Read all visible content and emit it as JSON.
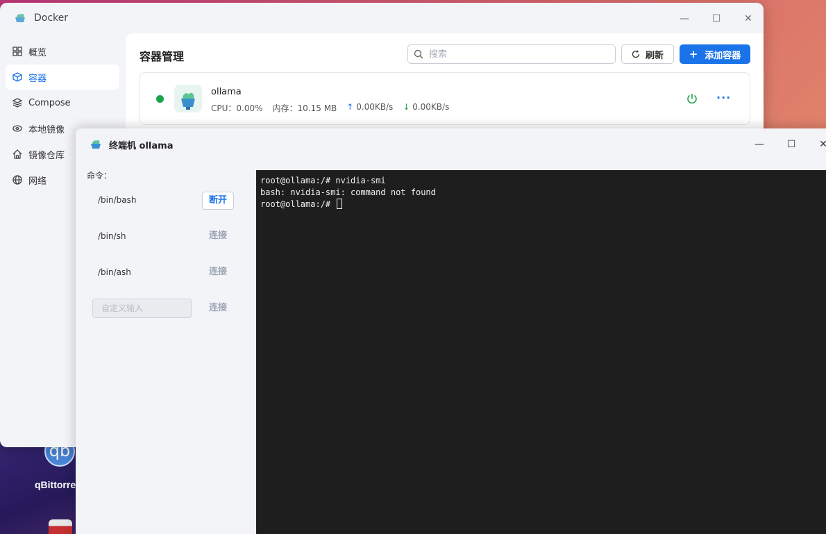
{
  "desktop": {
    "qbittorrent_label": "qBittorre"
  },
  "docker_window": {
    "title": "Docker",
    "sidebar": {
      "items": [
        {
          "label": "概览",
          "icon": "grid-icon"
        },
        {
          "label": "容器",
          "icon": "cube-icon",
          "active": true
        },
        {
          "label": "Compose",
          "icon": "layers-icon"
        },
        {
          "label": "本地镜像",
          "icon": "disk-icon"
        },
        {
          "label": "镜像仓库",
          "icon": "home-icon"
        },
        {
          "label": "网络",
          "icon": "globe-icon"
        }
      ]
    },
    "main": {
      "title": "容器管理",
      "search_placeholder": "搜索",
      "refresh_label": "刷新",
      "add_label": "添加容器",
      "container": {
        "name": "ollama",
        "status": "running",
        "status_color": "#1aa34a",
        "cpu": "CPU：0.00%",
        "memory": "内存：10.15 MB",
        "upload": "0.00KB/s",
        "download": "0.00KB/s"
      }
    }
  },
  "terminal_window": {
    "title": "终端机 ollama",
    "command_label": "命令：",
    "commands": [
      {
        "name": "/bin/bash",
        "action": "断开",
        "state": "connected"
      },
      {
        "name": "/bin/sh",
        "action": "连接",
        "state": "idle"
      },
      {
        "name": "/bin/ash",
        "action": "连接",
        "state": "idle"
      }
    ],
    "custom_placeholder": "自定义输入",
    "custom_action": "连接",
    "terminal_lines": [
      "root@ollama:/# nvidia-smi",
      "bash: nvidia-smi: command not found",
      "root@ollama:/# "
    ]
  },
  "colors": {
    "accent": "#1a73e8",
    "terminal_bg": "#1e1e1e"
  }
}
